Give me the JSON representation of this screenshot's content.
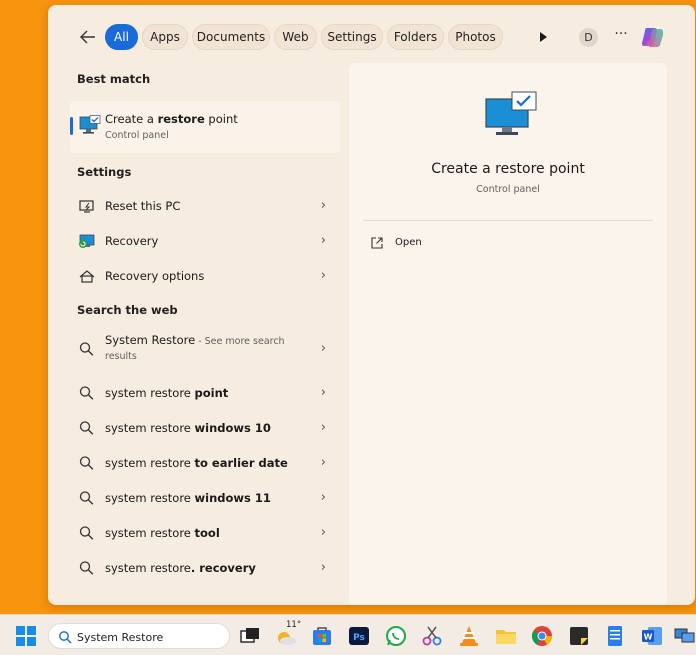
{
  "filters": {
    "tabs": [
      {
        "label": "All",
        "active": true
      },
      {
        "label": "Apps",
        "active": false
      },
      {
        "label": "Documents",
        "active": false
      },
      {
        "label": "Web",
        "active": false
      },
      {
        "label": "Settings",
        "active": false
      },
      {
        "label": "Folders",
        "active": false
      },
      {
        "label": "Photos",
        "active": false
      }
    ],
    "avatar_initial": "D",
    "more_label": "···"
  },
  "best_match": {
    "heading": "Best match",
    "title_prefix": "Create a ",
    "title_bold": "restore",
    "title_suffix": " point",
    "subtitle": "Control panel"
  },
  "settings": {
    "heading": "Settings",
    "items": [
      {
        "label": "Reset this PC",
        "icon": "reset-pc-icon"
      },
      {
        "label": "Recovery",
        "icon": "recovery-icon"
      },
      {
        "label": "Recovery options",
        "icon": "recovery-options-icon"
      }
    ]
  },
  "web": {
    "heading": "Search the web",
    "first": {
      "label": "System Restore",
      "see_more": " - See more search",
      "line2": "results"
    },
    "items": [
      {
        "plain": "system restore ",
        "bold": "point"
      },
      {
        "plain": "system restore ",
        "bold": "windows 10"
      },
      {
        "plain": "system restore ",
        "bold": "to earlier date"
      },
      {
        "plain": "system restore ",
        "bold": "windows 11"
      },
      {
        "plain": "system restore ",
        "bold": "tool"
      },
      {
        "plain": "system restore",
        "bold": ". recovery"
      }
    ]
  },
  "detail": {
    "title": "Create a restore point",
    "subtitle": "Control panel",
    "action_open": "Open"
  },
  "taskbar": {
    "search_value": "System Restore",
    "weather_temp": "11°",
    "apps": [
      "weather-icon",
      "task-view-icon",
      "store-icon",
      "photoshop-icon",
      "whatsapp-icon",
      "snipping-tool-icon",
      "vlc-icon",
      "file-explorer-icon",
      "chrome-icon",
      "sticky-notes-icon",
      "notepad-icon",
      "word-icon",
      "network-icon"
    ]
  },
  "colors": {
    "accent": "#1a6ad9",
    "desktop": "#f8940e",
    "panel": "#f7ece0"
  }
}
